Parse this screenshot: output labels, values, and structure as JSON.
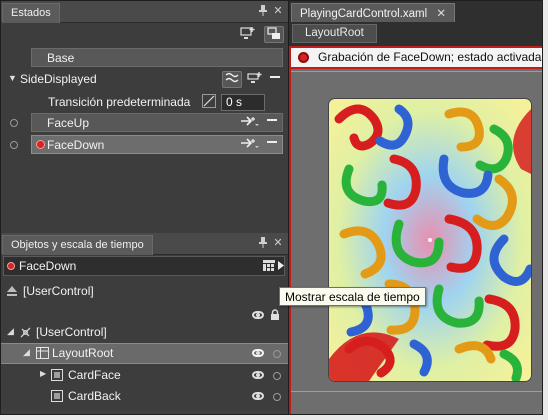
{
  "states_panel": {
    "title": "Estados",
    "base_label": "Base",
    "group_name": "SideDisplayed",
    "default_transition_label": "Transición predeterminada",
    "default_transition_value": "0 s",
    "states": [
      {
        "label": "FaceUp",
        "selected": false,
        "recording": false
      },
      {
        "label": "FaceDown",
        "selected": true,
        "recording": true
      }
    ]
  },
  "objects_panel": {
    "title": "Objetos y escala de tiempo",
    "current_state": "FaceDown",
    "scope_label": "[UserControl]",
    "tree": [
      {
        "label": "[UserControl]",
        "indent": 0,
        "selected": false
      },
      {
        "label": "LayoutRoot",
        "indent": 1,
        "selected": true
      },
      {
        "label": "CardFace",
        "indent": 2,
        "selected": false
      },
      {
        "label": "CardBack",
        "indent": 2,
        "selected": false
      }
    ]
  },
  "document": {
    "tab_label": "PlayingCardControl.xaml",
    "breadcrumb": "LayoutRoot",
    "recording_text": "Grabación de FaceDown; estado activada"
  },
  "tooltip": "Mostrar escala de tiempo",
  "colors": {
    "recording_red": "#c51a1a",
    "panel_bg": "#3d3d3d",
    "selection": "#6a6a6a"
  }
}
